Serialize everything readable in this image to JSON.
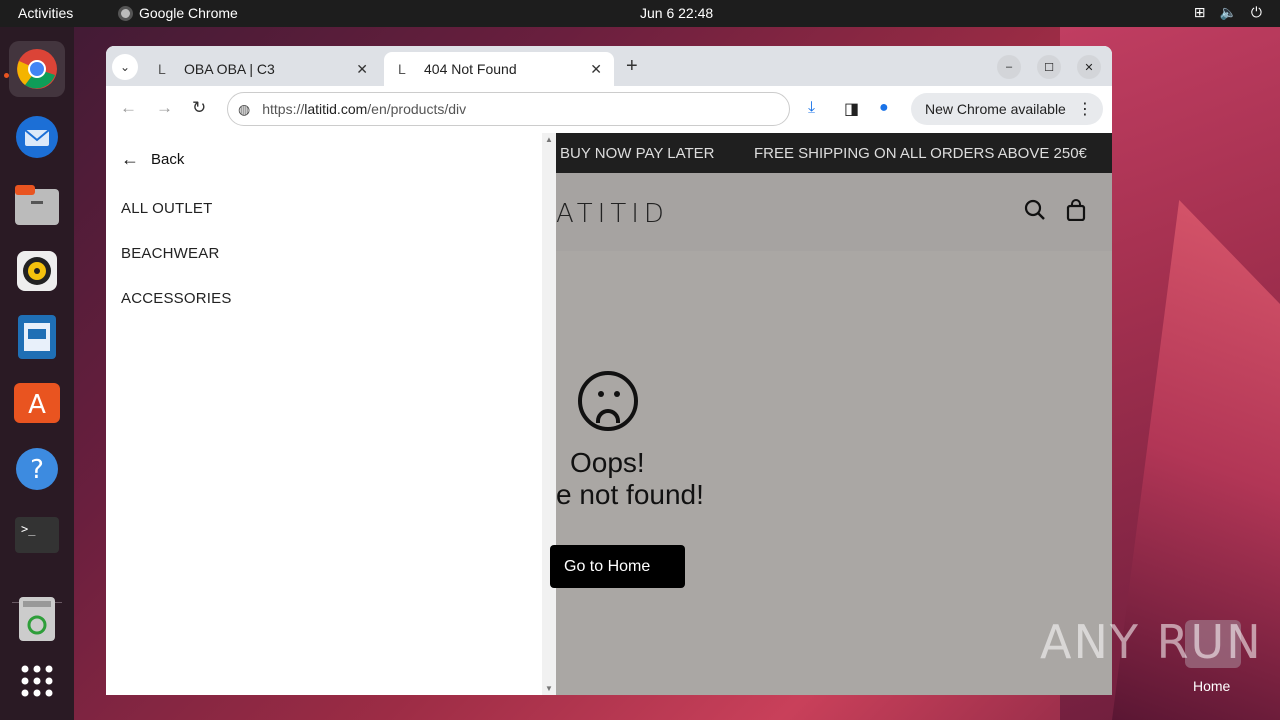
{
  "topbar": {
    "activities": "Activities",
    "app_name": "Google Chrome",
    "clock": "Jun 6  22:48",
    "tray": [
      "network-icon",
      "volume-icon",
      "power-icon"
    ]
  },
  "dock": {
    "apps": [
      "chrome-icon",
      "thunderbird-icon",
      "files-icon",
      "rhythmbox-icon",
      "writer-icon",
      "app-center-icon",
      "help-icon",
      "terminal-icon",
      "trash-icon",
      "app-grid-icon"
    ]
  },
  "browser": {
    "tabs": [
      {
        "title": "OBA OBA | C3",
        "favicon": "L",
        "active": false
      },
      {
        "title": "404 Not Found",
        "favicon": "L",
        "active": true
      }
    ],
    "new_tab": "+",
    "url_host": "latitid.com",
    "url_prefix": "https://",
    "url_path": "/en/products/div",
    "update_label": "New Chrome available"
  },
  "drawer": {
    "back_label": "Back",
    "items": [
      "ALL OUTLET",
      "BEACHWEAR",
      "ACCESSORIES"
    ]
  },
  "site": {
    "promo_1": "BUY NOW PAY LATER",
    "promo_2": "FREE SHIPPING ON ALL ORDERS ABOVE 250€",
    "logo": "ATITID",
    "oops": "Oops!",
    "not_found": "e not found!",
    "home_button": "Go to Home"
  },
  "desktop": {
    "watermark": "ANY RUN",
    "home_label": "Home"
  }
}
